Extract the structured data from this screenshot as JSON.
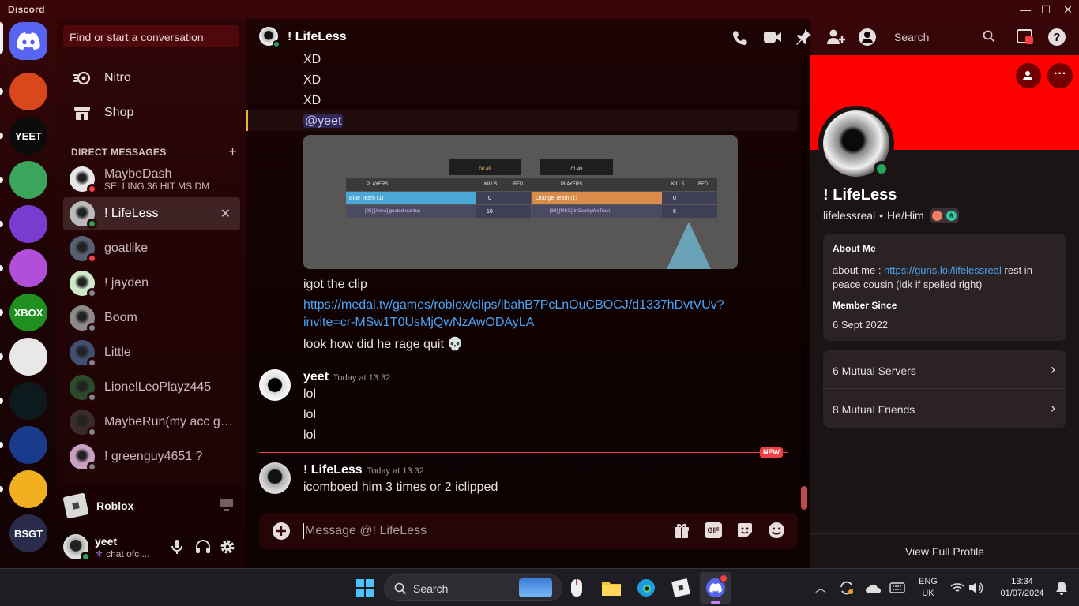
{
  "app": {
    "title": "Discord",
    "accent": "#5865f2"
  },
  "window": {
    "minimize": "—",
    "maximize": "☐",
    "close": "✕"
  },
  "servers": [
    {
      "name": "server-fire",
      "color": "#d9481c"
    },
    {
      "name": "server-yeet",
      "label": "YEET",
      "color": "#0b0b0b"
    },
    {
      "name": "server-kirby",
      "color": "#3ba55c"
    },
    {
      "name": "server-badge",
      "color": "#7a3bd1"
    },
    {
      "name": "server-cat",
      "color": "#b14fd8"
    },
    {
      "name": "server-xbox",
      "label": "XBOX",
      "color": "#1f8f1f"
    },
    {
      "name": "server-ghost",
      "color": "#e8e8e8"
    },
    {
      "name": "server-c",
      "color": "#0c1a1e"
    },
    {
      "name": "server-stars",
      "color": "#1a3b8c"
    },
    {
      "name": "server-roblox-face",
      "color": "#f0b020"
    },
    {
      "name": "server-bsgt",
      "label": "BSGT",
      "color": "#2a2a4a"
    }
  ],
  "sidebar": {
    "search_placeholder": "Find or start a conversation",
    "nitro": "Nitro",
    "shop": "Shop",
    "dm_header": "DIRECT MESSAGES",
    "dms": [
      {
        "name": "MaybeDash",
        "status": "dnd",
        "sub": "SELLING 36 HIT MS DM"
      },
      {
        "name": "! LifeLess",
        "status": "online",
        "active": true
      },
      {
        "name": "goatlike",
        "status": "dnd"
      },
      {
        "name": "! jayden",
        "status": "off"
      },
      {
        "name": "Boom",
        "status": "off"
      },
      {
        "name": "Little",
        "status": "off"
      },
      {
        "name": "LionelLeoPlayz445",
        "status": "off"
      },
      {
        "name": "MaybeRun(my acc got...",
        "status": "off"
      },
      {
        "name": "! greenguy4651 ?",
        "status": "off"
      }
    ],
    "activity": "Roblox",
    "user": {
      "name": "yeet",
      "status_text": "chat ofc ..."
    }
  },
  "chat": {
    "recipient": "! LifeLess",
    "search_placeholder": "Search",
    "messages_top": [
      "XD",
      "XD",
      "XD"
    ],
    "mention": "@yeet",
    "embed": {
      "players_label": "PLAYERS",
      "kills_label": "KILLS",
      "bed_label": "BED",
      "blue_team": "Blue Team (1)",
      "orange_team": "Orange Team (1)",
      "blue_kills": "0",
      "orange_kills": "0",
      "blue_player": "[25] [Xiera] goated wahhaj",
      "orange_player": "[38] [MSG] InCoolzyWeTrust",
      "blue_player_kills": "10",
      "orange_player_kills": "6",
      "timer_left": "00:49",
      "timer_right": "01:49"
    },
    "clip_text": "igot the clip",
    "clip_link_1": "https://medal.tv/games/roblox/clips/ibahB7PcLnOuCBOCJ/d1337hDvtVUv?",
    "clip_link_2": "invite=cr-MSw1T0UsMjQwNzAwODAyLA",
    "rage_text": "look how did he rage quit 💀",
    "group2": {
      "author": "yeet",
      "time": "Today at 13:32",
      "lines": [
        "lol",
        "lol",
        "lol"
      ]
    },
    "new_badge": "NEW",
    "group3": {
      "author": "! LifeLess",
      "time": "Today at 13:32",
      "lines": [
        "icomboed him 3 times or 2 iclipped"
      ]
    },
    "composer_placeholder": "Message @! LifeLess",
    "gif_label": "GIF"
  },
  "profile": {
    "display_name": "! LifeLess",
    "username": "lifelessreal",
    "pronouns": "He/Him",
    "banner_color": "#ff0000",
    "about_title": "About Me",
    "about_prefix": "about me : ",
    "about_link": "https://guns.lol/lifelessreal",
    "about_suffix": " rest in peace cousin (idk if spelled right)",
    "member_since_title": "Member Since",
    "member_since": "6 Sept 2022",
    "mutual_servers": "6 Mutual Servers",
    "mutual_friends": "8 Mutual Friends",
    "view_full": "View Full Profile"
  },
  "taskbar": {
    "search": "Search",
    "lang_1": "ENG",
    "lang_2": "UK",
    "time": "13:34",
    "date": "01/07/2024"
  }
}
